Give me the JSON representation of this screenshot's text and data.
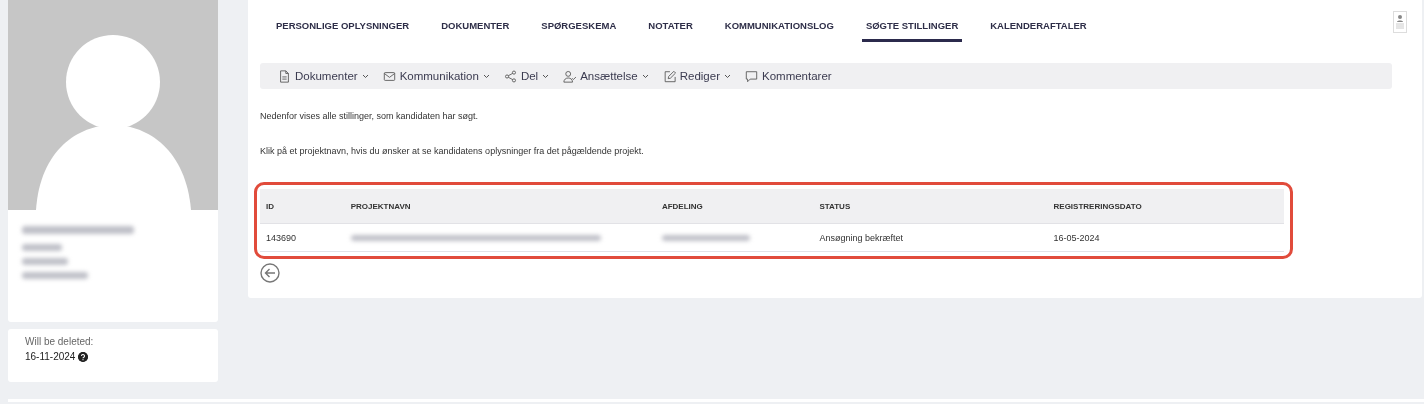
{
  "profile": {
    "deletion_label": "Will be deleted:",
    "deletion_date": "16-11-2024"
  },
  "tabs": [
    {
      "label": "PERSONLIGE OPLYSNINGER",
      "selected": false
    },
    {
      "label": "DOKUMENTER",
      "selected": false
    },
    {
      "label": "SPØRGESKEMA",
      "selected": false
    },
    {
      "label": "NOTATER",
      "selected": false
    },
    {
      "label": "KOMMUNIKATIONSLOG",
      "selected": false
    },
    {
      "label": "SØGTE STILLINGER",
      "selected": true
    },
    {
      "label": "KALENDERAFTALER",
      "selected": false
    }
  ],
  "toolbar": [
    {
      "kind": "document",
      "label": "Dokumenter",
      "dropdown": true
    },
    {
      "kind": "mail",
      "label": "Kommunikation",
      "dropdown": true
    },
    {
      "kind": "share",
      "label": "Del",
      "dropdown": true
    },
    {
      "kind": "person",
      "label": "Ansættelse",
      "dropdown": true
    },
    {
      "kind": "edit",
      "label": "Rediger",
      "dropdown": true
    },
    {
      "kind": "comment",
      "label": "Kommentarer",
      "dropdown": false
    }
  ],
  "intro": [
    "Nedenfor vises alle stillinger, som kandidaten har søgt.",
    "Klik på et projektnavn, hvis du ønsker at se kandidatens oplysninger fra det pågældende projekt."
  ],
  "table": {
    "columns": [
      "ID",
      "PROJEKTNAVN",
      "AFDELING",
      "STATUS",
      "REGISTRERINGSDATO"
    ],
    "rows": [
      {
        "id": "143690",
        "status": "Ansøgning bekræftet",
        "date": "16-05-2024"
      }
    ]
  }
}
